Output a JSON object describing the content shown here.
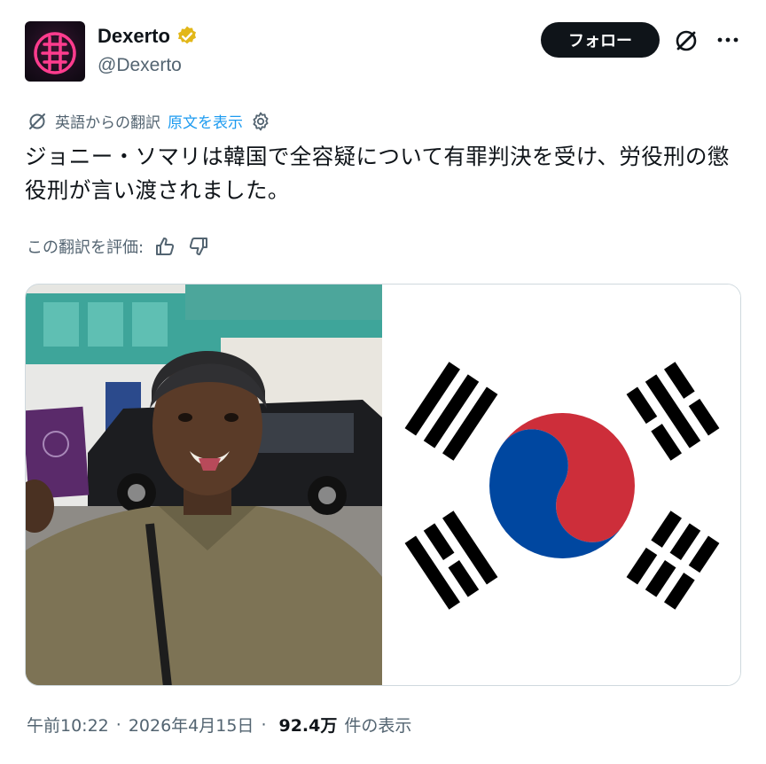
{
  "author": {
    "display_name": "Dexerto",
    "handle": "@Dexerto",
    "verified": true,
    "verified_color": "#e2b719",
    "avatar_icon": "dexerto-logo-icon"
  },
  "header_actions": {
    "follow_label": "フォロー",
    "grok_icon": "grok-icon",
    "more_icon": "more-horizontal-icon"
  },
  "translation": {
    "from_label": "英語からの翻訳",
    "show_original_label": "原文を表示",
    "icon": "translate-icon",
    "settings_icon": "gear-icon",
    "link_color": "#1d9bf0"
  },
  "tweet": {
    "text": "ジョニー・ソマリは韓国で全容疑について有罪判決を受け、労役刑の懲役刑が言い渡されました。"
  },
  "rate_translation": {
    "label": "この翻訳を評価:",
    "thumbs_up_icon": "thumbs-up-icon",
    "thumbs_down_icon": "thumbs-down-icon"
  },
  "media": {
    "photo_icon": "photo-man-with-passport",
    "flag_icon": "south-korea-flag",
    "flag_colors": {
      "red": "#cd2e3a",
      "blue": "#0047a0",
      "black": "#000000"
    }
  },
  "meta": {
    "time": "午前10:22",
    "date": "2026年4月15日",
    "separator": "·",
    "views_count": "92.4万",
    "views_label": "件の表示"
  }
}
